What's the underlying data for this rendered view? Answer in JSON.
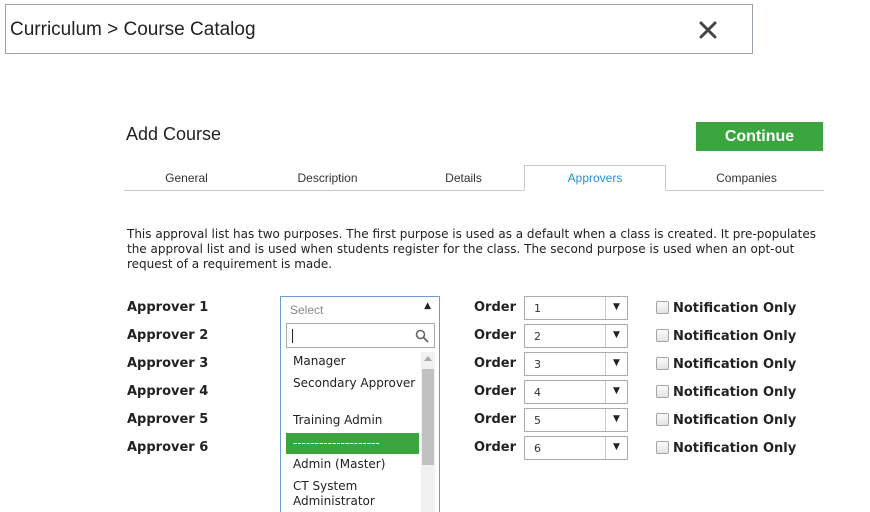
{
  "breadcrumb": {
    "text": "Curriculum > Course Catalog"
  },
  "header": {
    "title": "Add Course",
    "continue_label": "Continue"
  },
  "tabs": [
    {
      "label": "General",
      "active": false
    },
    {
      "label": "Description",
      "active": false
    },
    {
      "label": "Details",
      "active": false
    },
    {
      "label": "Approvers",
      "active": true
    },
    {
      "label": "Companies",
      "active": false
    }
  ],
  "description": "This approval list has two purposes. The first purpose is used as a default when a class is created. It pre-populates the approval list and is used when students register for the class. The second purpose is used when an opt-out request of a requirement is made.",
  "approvers": [
    {
      "label": "Approver 1",
      "order_label": "Order",
      "order_value": "1",
      "notification_label": "Notification Only",
      "checked": false
    },
    {
      "label": "Approver 2",
      "order_label": "Order",
      "order_value": "2",
      "notification_label": "Notification Only",
      "checked": false
    },
    {
      "label": "Approver 3",
      "order_label": "Order",
      "order_value": "3",
      "notification_label": "Notification Only",
      "checked": false
    },
    {
      "label": "Approver 4",
      "order_label": "Order",
      "order_value": "4",
      "notification_label": "Notification Only",
      "checked": false
    },
    {
      "label": "Approver 5",
      "order_label": "Order",
      "order_value": "5",
      "notification_label": "Notification Only",
      "checked": false
    },
    {
      "label": "Approver 6",
      "order_label": "Order",
      "order_value": "6",
      "notification_label": "Notification Only",
      "checked": false
    }
  ],
  "approver_select": {
    "placeholder": "Select",
    "search_value": "",
    "options": [
      {
        "label": "Manager",
        "highlighted": false
      },
      {
        "label": "Secondary Approver",
        "highlighted": false
      },
      {
        "label": "Training Admin",
        "highlighted": false
      },
      {
        "label": "--------------------",
        "highlighted": true
      },
      {
        "label": "Admin (Master)",
        "highlighted": false
      },
      {
        "label": "CT System Administrator",
        "highlighted": false
      }
    ]
  },
  "colors": {
    "accent_green": "#3ba63f",
    "active_tab_text": "#2a8fcf",
    "focus_border": "#6a9cd0"
  },
  "icons": {
    "close": "close-icon",
    "search": "search-icon",
    "dropdown": "chevron-down-icon",
    "dropdown_open": "chevron-up-icon"
  }
}
